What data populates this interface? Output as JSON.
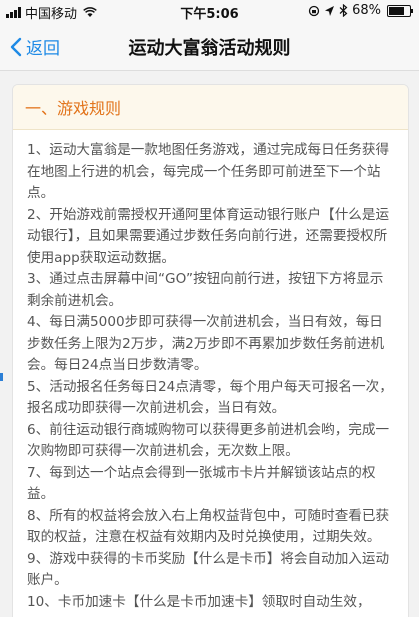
{
  "status_bar": {
    "carrier": "中国移动",
    "time": "下午5:06",
    "battery": "68%",
    "battery_level": 0.68
  },
  "nav": {
    "back_label": "返回",
    "title": "运动大富翁活动规则"
  },
  "section": {
    "title": "一、游戏规则"
  },
  "rules": [
    "1、运动大富翁是一款地图任务游戏，通过完成每日任务获得在地图上行进的机会，每完成一个任务即可前进至下一个站点。",
    "2、开始游戏前需授权开通阿里体育运动银行账户【什么是运动银行】，且如果需要通过步数任务向前行进，还需要授权所使用app获取运动数据。",
    "3、通过点击屏幕中间“GO”按钮向前行进，按钮下方将显示剩余前进机会。",
    "4、每日满5000步即可获得一次前进机会，当日有效，每日步数任务上限为2万步，满2万步即不再累加步数任务前进机会。每日24点当日步数清零。",
    "5、活动报名任务每日24点清零，每个用户每天可报名一次，报名成功即获得一次前进机会，当日有效。",
    "6、前往运动银行商城购物可以获得更多前进机会哟，完成一次购物即可获得一次前进机会，无次数上限。",
    "7、每到达一个站点会得到一张城市卡片并解锁该站点的权益。",
    "8、所有的权益将会放入右上角权益背包中，可随时查看已获取的权益，注意在权益有效期内及时兑换使用，过期失效。",
    "9、游戏中获得的卡币奖励【什么是卡币】将会自动加入运动账户。",
    "10、卡币加速卡【什么是卡币加速卡】领取时自动生效，"
  ]
}
